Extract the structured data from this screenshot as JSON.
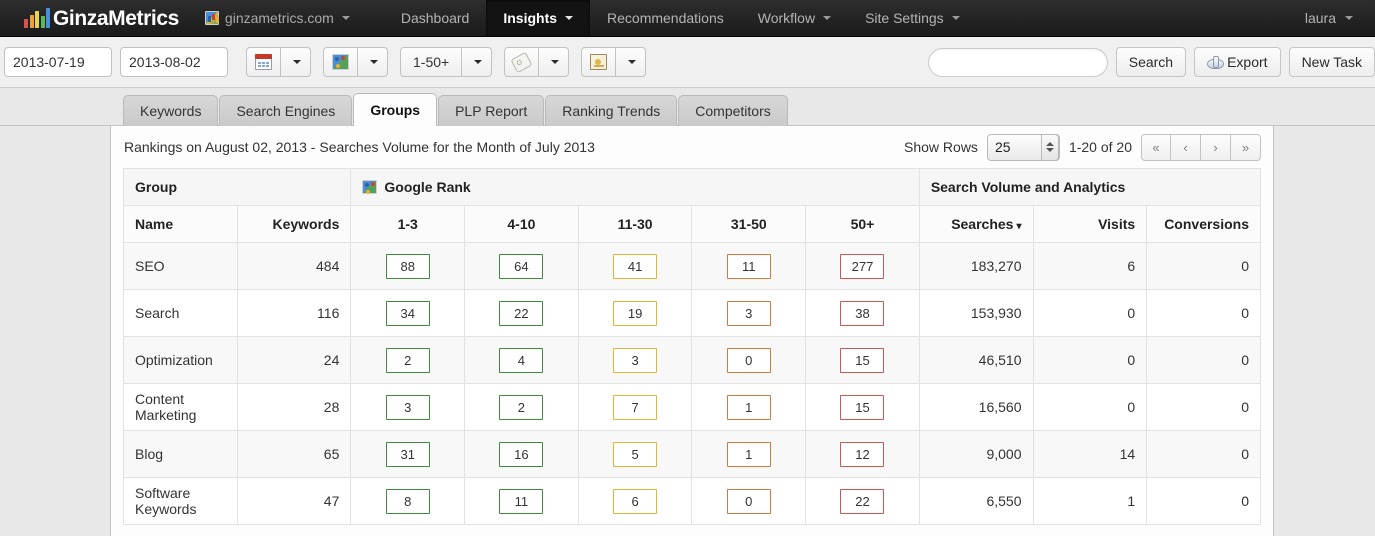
{
  "header": {
    "brand": "GinzaMetrics",
    "logo_bars": [
      {
        "color": "#d9534f",
        "height": 9
      },
      {
        "color": "#e8a33d",
        "height": 13
      },
      {
        "color": "#e8d44d",
        "height": 17
      },
      {
        "color": "#5cb85c",
        "height": 12
      },
      {
        "color": "#4a90d9",
        "height": 20
      }
    ],
    "site_selector": "ginzametrics.com",
    "nav": [
      {
        "label": "Dashboard",
        "active": false,
        "has_caret": false
      },
      {
        "label": "Insights",
        "active": true,
        "has_caret": true
      },
      {
        "label": "Recommendations",
        "active": false,
        "has_caret": false
      },
      {
        "label": "Workflow",
        "active": false,
        "has_caret": true
      },
      {
        "label": "Site Settings",
        "active": false,
        "has_caret": true
      }
    ],
    "user": "laura"
  },
  "toolbar": {
    "date_from": "2013-07-19",
    "date_to": "2013-08-02",
    "rank_range_label": "1-50+",
    "search_value": "",
    "search_placeholder": "",
    "search_button": "Search",
    "export_button": "Export",
    "new_task_button": "New Task",
    "icons": [
      "calendar-icon",
      "google-icon",
      "tag-icon",
      "money-icon"
    ]
  },
  "tabs": [
    {
      "label": "Keywords",
      "active": false
    },
    {
      "label": "Search Engines",
      "active": false
    },
    {
      "label": "Groups",
      "active": true
    },
    {
      "label": "PLP Report",
      "active": false
    },
    {
      "label": "Ranking Trends",
      "active": false
    },
    {
      "label": "Competitors",
      "active": false
    }
  ],
  "panel": {
    "title": "Rankings on August 02, 2013 - Searches Volume for the Month of July 2013",
    "show_rows_label": "Show Rows",
    "rows_per_page": "25",
    "range_label": "1-20 of 20",
    "pager": [
      "«",
      "‹",
      "›",
      "»"
    ]
  },
  "table": {
    "group_headers": [
      {
        "label": "Group",
        "colspan": 2,
        "icon": null
      },
      {
        "label": "Google Rank",
        "colspan": 5,
        "icon": "google-icon"
      },
      {
        "label": "Search Volume and Analytics",
        "colspan": 3,
        "icon": null
      }
    ],
    "columns": [
      {
        "label": "Name",
        "align": "left"
      },
      {
        "label": "Keywords",
        "align": "right"
      },
      {
        "label": "1-3",
        "align": "center"
      },
      {
        "label": "4-10",
        "align": "center"
      },
      {
        "label": "11-30",
        "align": "center"
      },
      {
        "label": "31-50",
        "align": "center"
      },
      {
        "label": "50+",
        "align": "center"
      },
      {
        "label": "Searches",
        "align": "right",
        "sorted": true,
        "sort_dir": "▾"
      },
      {
        "label": "Visits",
        "align": "right"
      },
      {
        "label": "Conversions",
        "align": "right"
      }
    ],
    "rows": [
      {
        "name": "SEO",
        "keywords": "484",
        "r1_3": "88",
        "r4_10": "64",
        "r11_30": "41",
        "r31_50": "11",
        "r50plus": "277",
        "searches": "183,270",
        "visits": "6",
        "conversions": "0"
      },
      {
        "name": "Search",
        "keywords": "116",
        "r1_3": "34",
        "r4_10": "22",
        "r11_30": "19",
        "r31_50": "3",
        "r50plus": "38",
        "searches": "153,930",
        "visits": "0",
        "conversions": "0"
      },
      {
        "name": "Optimization",
        "keywords": "24",
        "r1_3": "2",
        "r4_10": "4",
        "r11_30": "3",
        "r31_50": "0",
        "r50plus": "15",
        "searches": "46,510",
        "visits": "0",
        "conversions": "0"
      },
      {
        "name": "Content Marketing",
        "keywords": "28",
        "r1_3": "3",
        "r4_10": "2",
        "r11_30": "7",
        "r31_50": "1",
        "r50plus": "15",
        "searches": "16,560",
        "visits": "0",
        "conversions": "0"
      },
      {
        "name": "Blog",
        "keywords": "65",
        "r1_3": "31",
        "r4_10": "16",
        "r11_30": "5",
        "r31_50": "1",
        "r50plus": "12",
        "searches": "9,000",
        "visits": "14",
        "conversions": "0"
      },
      {
        "name": "Software Keywords",
        "keywords": "47",
        "r1_3": "8",
        "r4_10": "11",
        "r11_30": "6",
        "r31_50": "0",
        "r50plus": "22",
        "searches": "6,550",
        "visits": "1",
        "conversions": "0"
      }
    ]
  },
  "colors": {
    "badge_green": "#3f8a3f",
    "badge_yellow": "#e0b63a",
    "badge_orange": "#d2793c",
    "badge_red": "#c75a53",
    "nav_bg": "#222222",
    "page_bg": "#e8e8e8"
  }
}
